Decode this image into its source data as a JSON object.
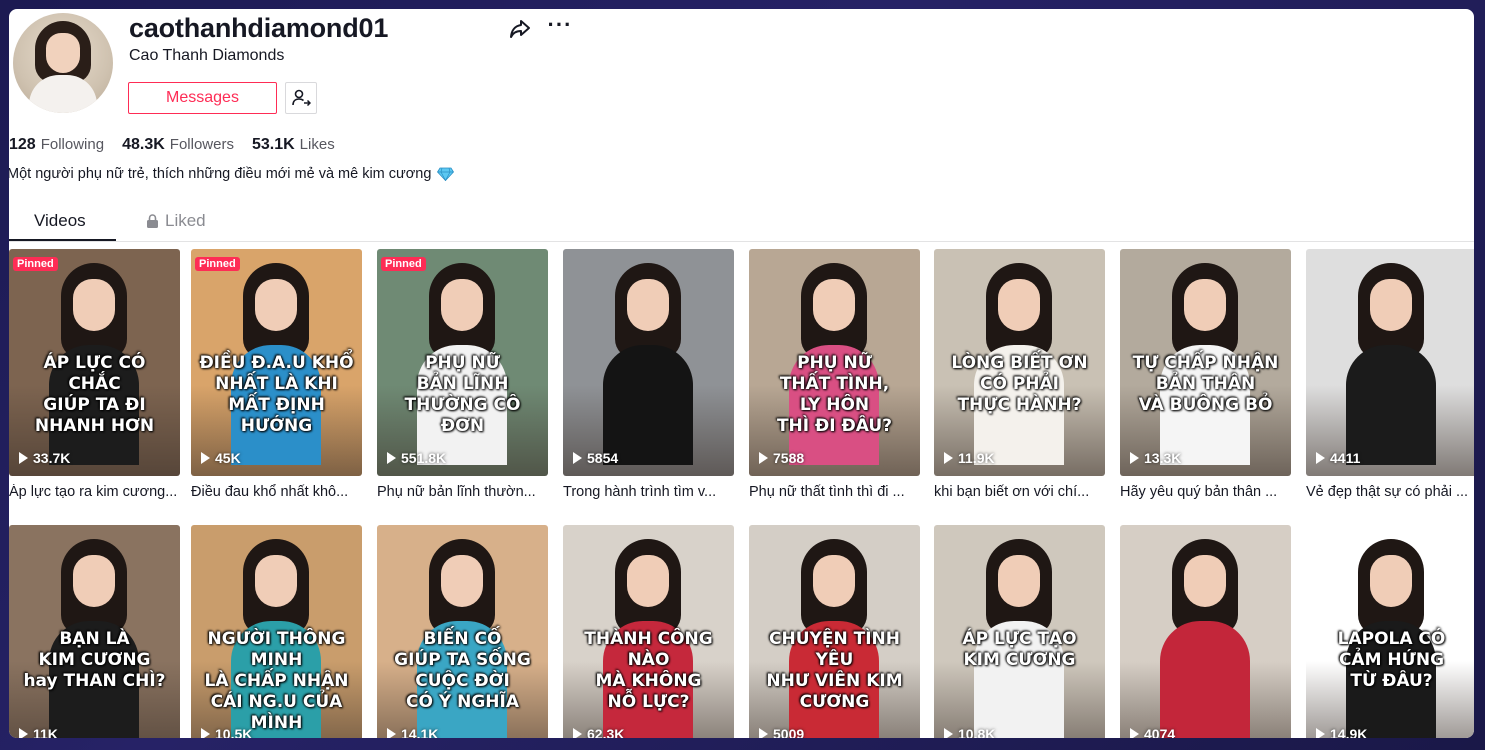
{
  "profile": {
    "username": "caothanhdiamond01",
    "nickname": "Cao Thanh Diamonds",
    "messages_label": "Messages",
    "stats": {
      "following_count": "128",
      "following_label": "Following",
      "followers_count": "48.3K",
      "followers_label": "Followers",
      "likes_count": "53.1K",
      "likes_label": "Likes"
    },
    "bio": "Một người phụ nữ trẻ, thích những điều mới mẻ và mê kim cương"
  },
  "tabs": {
    "videos": "Videos",
    "liked": "Liked"
  },
  "colors": {
    "accent": "#fe2c55",
    "text": "#161823",
    "secondary": "#57575f"
  },
  "videos": [
    {
      "pinned": "Pinned",
      "views": "33.7K",
      "desc": "Áp lực tạo ra kim cương...",
      "art": "ÁP LỰC CÓ CHẮC\nGIÚP TA ĐI\nNHANH HƠN",
      "bg": "#7d6450",
      "outfit": "#1c1c1c"
    },
    {
      "pinned": "Pinned",
      "views": "45K",
      "desc": "Điều đau khổ nhất khô...",
      "art": "ĐIỀU Đ.A.U KHỔ\nNHẤT LÀ KHI\nMẤT ĐỊNH HƯỚNG",
      "bg": "#d9a46a",
      "outfit": "#2b8fc9"
    },
    {
      "pinned": "Pinned",
      "views": "551.8K",
      "desc": "Phụ nữ bản lĩnh thườn...",
      "art": "PHỤ NỮ\nBẢN LĨNH\nTHƯỜNG CÔ ĐƠN",
      "bg": "#6f8a74",
      "outfit": "#f2f2f2"
    },
    {
      "pinned": "",
      "views": "5854",
      "desc": "Trong hành trình tìm v...",
      "art": "",
      "bg": "#8f9296",
      "outfit": "#141414"
    },
    {
      "pinned": "",
      "views": "7588",
      "desc": "Phụ nữ thất tình thì đi ...",
      "art": "PHỤ NỮ\nTHẤT TÌNH,\nLY HÔN\nTHÌ ĐI ĐÂU?",
      "bg": "#b8a794",
      "outfit": "#d94f83"
    },
    {
      "pinned": "",
      "views": "11.9K",
      "desc": "khi bạn biết ơn với chí...",
      "art": "LÒNG BIẾT ƠN\nCÓ PHẢI\nTHỰC HÀNH?",
      "bg": "#c9c1b4",
      "outfit": "#f4f1ec"
    },
    {
      "pinned": "",
      "views": "13.3K",
      "desc": "Hãy yêu quý bản thân ...",
      "art": "TỰ CHẤP NHẬN BẢN THÂN\nVÀ BUÔNG BỎ",
      "bg": "#b3aa9d",
      "outfit": "#f5f5f5"
    },
    {
      "pinned": "",
      "views": "4411",
      "desc": "Vẻ đẹp thật sự có phải ...",
      "art": "",
      "bg": "#dedede",
      "outfit": "#1b1b1b"
    },
    {
      "pinned": "",
      "views": "11K",
      "desc": "",
      "art": "BẠN LÀ\nKIM CƯƠNG\nhay THAN CHÌ?",
      "bg": "#8a7360",
      "outfit": "#1c1c1c"
    },
    {
      "pinned": "",
      "views": "10.5K",
      "desc": "",
      "art": "NGƯỜI THÔNG MINH\nLÀ CHẤP NHẬN\nCÁI NG.U CỦA MÌNH",
      "bg": "#c99d6c",
      "outfit": "#2b9fa8"
    },
    {
      "pinned": "",
      "views": "14.1K",
      "desc": "",
      "art": "BIẾN CỐ\nGIÚP TA SỐNG\nCUỘC ĐỜI\nCÓ Ý NGHĨA",
      "bg": "#d7b08a",
      "outfit": "#3aa6c4"
    },
    {
      "pinned": "",
      "views": "62.3K",
      "desc": "",
      "art": "THÀNH CÔNG NÀO\nMÀ KHÔNG\nNỖ LỰC?",
      "bg": "#d8d2ca",
      "outfit": "#c5283c"
    },
    {
      "pinned": "",
      "views": "5009",
      "desc": "",
      "art": "CHUYỆN TÌNH YÊU\nNHƯ VIÊN KIM CƯƠNG",
      "bg": "#d4cec6",
      "outfit": "#c92a35"
    },
    {
      "pinned": "",
      "views": "10.8K",
      "desc": "",
      "art": "ÁP LỰC TẠO\nKIM CƯƠNG",
      "bg": "#cfc8bd",
      "outfit": "#f2f2f2"
    },
    {
      "pinned": "",
      "views": "4074",
      "desc": "",
      "art": "",
      "bg": "#d6cec5",
      "outfit": "#c3263a"
    },
    {
      "pinned": "",
      "views": "14.9K",
      "desc": "",
      "art": "LAPOLA CÓ\nCẢM HỨNG\nTỪ ĐÂU?",
      "bg": "#ffffff",
      "outfit": "#1a1a1a"
    }
  ]
}
